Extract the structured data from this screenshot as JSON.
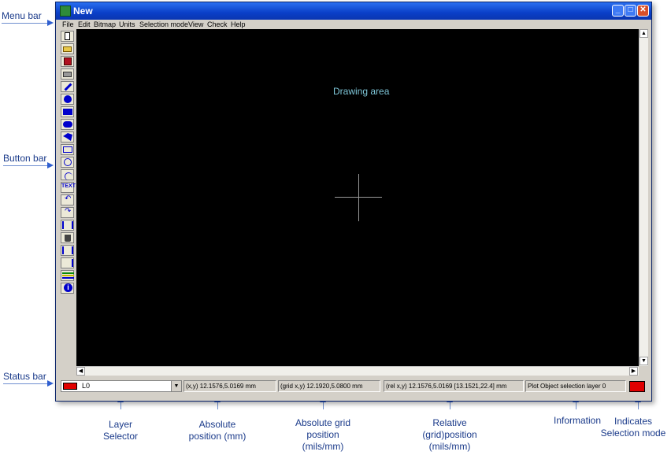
{
  "annotations": {
    "menu_bar": "Menu bar",
    "button_bar": "Button bar",
    "status_bar": "Status bar",
    "drawing_area": "Drawing area",
    "layer_selector": "Layer\nSelector",
    "absolute_position": "Absolute\nposition (mm)",
    "absolute_grid_position": "Absolute grid\nposition\n(mils/mm)",
    "relative_position": "Relative\n(grid)position\n(mils/mm)",
    "information": "Information",
    "indicates_selection_mode": "Indicates\nSelection mode"
  },
  "window": {
    "title": "New",
    "controls": {
      "minimize": "_",
      "maximize": "□",
      "close": "✕"
    }
  },
  "menu": [
    "File",
    "Edit",
    "Bitmap",
    "Units",
    "Selection mode",
    "View",
    "Check",
    "Help"
  ],
  "toolbar": {
    "buttons": [
      "new-file",
      "open-folder",
      "save-disk",
      "print",
      "pencil",
      "filled-circle",
      "filled-rectangle",
      "filled-rounded-rect",
      "filled-polygon",
      "rectangle-outline",
      "circle-outline",
      "arc",
      "text",
      "undo",
      "redo",
      "move",
      "delete-bin",
      "copy",
      "flip",
      "layers",
      "info"
    ],
    "text_button": "TEXT"
  },
  "status": {
    "layer": "L0",
    "abs_position": "(x,y) 12.1576,5.0169 mm",
    "grid_position": "(grid x,y) 12.1920,5.0800 mm",
    "rel_position": "(rel x,y) 12.1576,5.0169 [13.1521,22.4] mm",
    "info": "Plot Object selection layer 0"
  },
  "colors": {
    "layer_swatch": "#e00000",
    "selection_mode": "#e00000",
    "drawing_bg": "#000000",
    "drawing_label": "#7ec6d8"
  }
}
